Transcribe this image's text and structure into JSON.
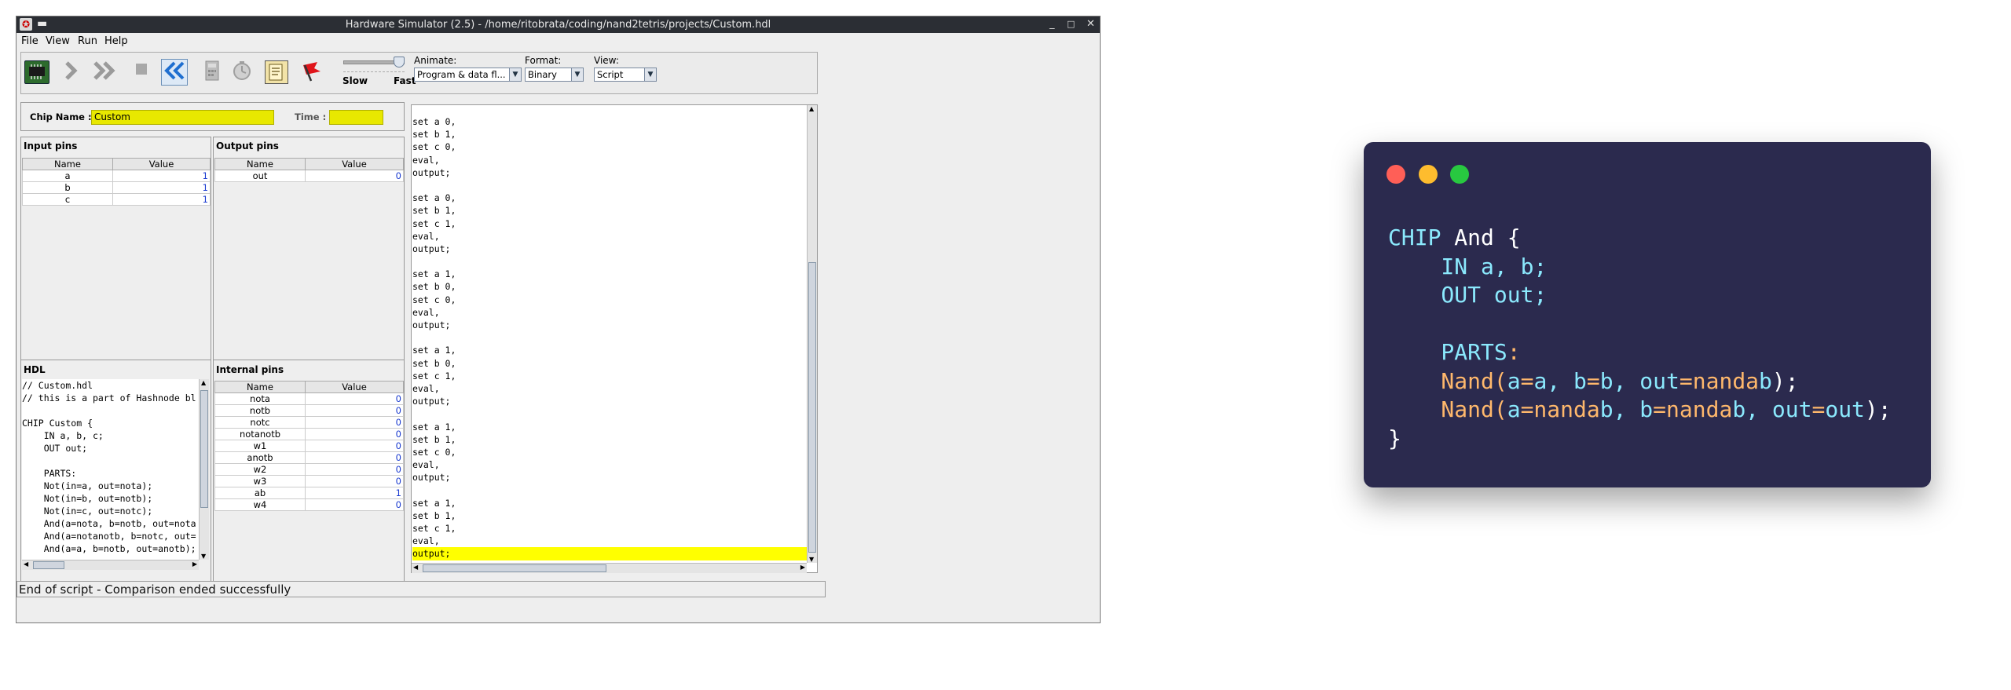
{
  "window": {
    "title": "Hardware Simulator (2.5) - /home/ritobrata/coding/nand2tetris/projects/Custom.hdl",
    "controls": {
      "minimize": "_",
      "maximize": "□",
      "close": "✕"
    }
  },
  "menu": {
    "file": "File",
    "view": "View",
    "run": "Run",
    "help": "Help"
  },
  "toolbar": {
    "icons": [
      "chip-icon",
      "step-icon",
      "fast-forward-icon",
      "stop-icon",
      "rewind-icon",
      "eval-icon",
      "clock-icon",
      "script-icon",
      "breakpoint-icon"
    ],
    "speed": {
      "slow": "Slow",
      "fast": "Fast"
    },
    "animate": {
      "label": "Animate:",
      "value": "Program & data fl..."
    },
    "format": {
      "label": "Format:",
      "value": "Binary"
    },
    "view": {
      "label": "View:",
      "value": "Script"
    }
  },
  "chip": {
    "name_label": "Chip Name :",
    "name_value": "Custom",
    "time_label": "Time :",
    "time_value": ""
  },
  "input_pins": {
    "title": "Input pins",
    "headers": [
      "Name",
      "Value"
    ],
    "rows": [
      {
        "name": "a",
        "value": "1"
      },
      {
        "name": "b",
        "value": "1"
      },
      {
        "name": "c",
        "value": "1"
      }
    ]
  },
  "output_pins": {
    "title": "Output pins",
    "headers": [
      "Name",
      "Value"
    ],
    "rows": [
      {
        "name": "out",
        "value": "0"
      }
    ]
  },
  "hdl": {
    "title": "HDL",
    "lines": [
      "// Custom.hdl",
      "// this is a part of Hashnode bl",
      "",
      "CHIP Custom {",
      "    IN a, b, c;",
      "    OUT out;",
      "",
      "    PARTS:",
      "    Not(in=a, out=nota);",
      "    Not(in=b, out=notb);",
      "    Not(in=c, out=notc);",
      "    And(a=nota, b=notb, out=nota",
      "    And(a=notanotb, b=notc, out=",
      "    And(a=a, b=notb, out=anotb);"
    ]
  },
  "internal_pins": {
    "title": "Internal pins",
    "headers": [
      "Name",
      "Value"
    ],
    "rows": [
      {
        "name": "nota",
        "value": "0"
      },
      {
        "name": "notb",
        "value": "0"
      },
      {
        "name": "notc",
        "value": "0"
      },
      {
        "name": "notanotb",
        "value": "0"
      },
      {
        "name": "w1",
        "value": "0"
      },
      {
        "name": "anotb",
        "value": "0"
      },
      {
        "name": "w2",
        "value": "0"
      },
      {
        "name": "w3",
        "value": "0"
      },
      {
        "name": "ab",
        "value": "1"
      },
      {
        "name": "w4",
        "value": "0"
      }
    ]
  },
  "script": {
    "lines": [
      "set a 0,",
      "set b 1,",
      "set c 0,",
      "eval,",
      "output;",
      "",
      "set a 0,",
      "set b 1,",
      "set c 1,",
      "eval,",
      "output;",
      "",
      "set a 1,",
      "set b 0,",
      "set c 0,",
      "eval,",
      "output;",
      "",
      "set a 1,",
      "set b 0,",
      "set c 1,",
      "eval,",
      "output;",
      "",
      "set a 1,",
      "set b 1,",
      "set c 0,",
      "eval,",
      "output;",
      "",
      "set a 1,",
      "set b 1,",
      "set c 1,",
      "eval,",
      "output;"
    ],
    "highlight_line": 34,
    "highlight_color": "#ffff00"
  },
  "status": {
    "message": "End of script - Comparison ended successfully"
  },
  "code_card": {
    "background": "#2b2a4e",
    "dots": [
      "#ff5f57",
      "#febc2e",
      "#28c840"
    ],
    "lines": [
      [
        {
          "t": "CHIP ",
          "c": "#8be9fd"
        },
        {
          "t": "And {",
          "c": "#ffffff"
        }
      ],
      [
        {
          "t": "    IN a, b;",
          "c": "#8be9fd"
        }
      ],
      [
        {
          "t": "    OUT out;",
          "c": "#8be9fd"
        }
      ],
      [
        {
          "t": "",
          "c": "#ffffff"
        }
      ],
      [
        {
          "t": "    PARTS",
          "c": "#8be9fd"
        },
        {
          "t": ":",
          "c": "#ffb86c"
        }
      ],
      [
        {
          "t": "    Nand(",
          "c": "#ffb86c"
        },
        {
          "t": "a",
          "c": "#8be9fd"
        },
        {
          "t": "=",
          "c": "#ffb86c"
        },
        {
          "t": "a, b",
          "c": "#8be9fd"
        },
        {
          "t": "=",
          "c": "#ffb86c"
        },
        {
          "t": "b, out",
          "c": "#8be9fd"
        },
        {
          "t": "=nanda",
          "c": "#ffb86c"
        },
        {
          "t": "b",
          "c": "#8be9fd"
        },
        {
          "t": ");",
          "c": "#ffffff"
        }
      ],
      [
        {
          "t": "    Nand(",
          "c": "#ffb86c"
        },
        {
          "t": "a",
          "c": "#8be9fd"
        },
        {
          "t": "=nanda",
          "c": "#ffb86c"
        },
        {
          "t": "b, b",
          "c": "#8be9fd"
        },
        {
          "t": "=nanda",
          "c": "#ffb86c"
        },
        {
          "t": "b, out",
          "c": "#8be9fd"
        },
        {
          "t": "=",
          "c": "#ffb86c"
        },
        {
          "t": "out",
          "c": "#8be9fd"
        },
        {
          "t": ");",
          "c": "#ffffff"
        }
      ],
      [
        {
          "t": "}",
          "c": "#ffffff"
        }
      ]
    ]
  }
}
